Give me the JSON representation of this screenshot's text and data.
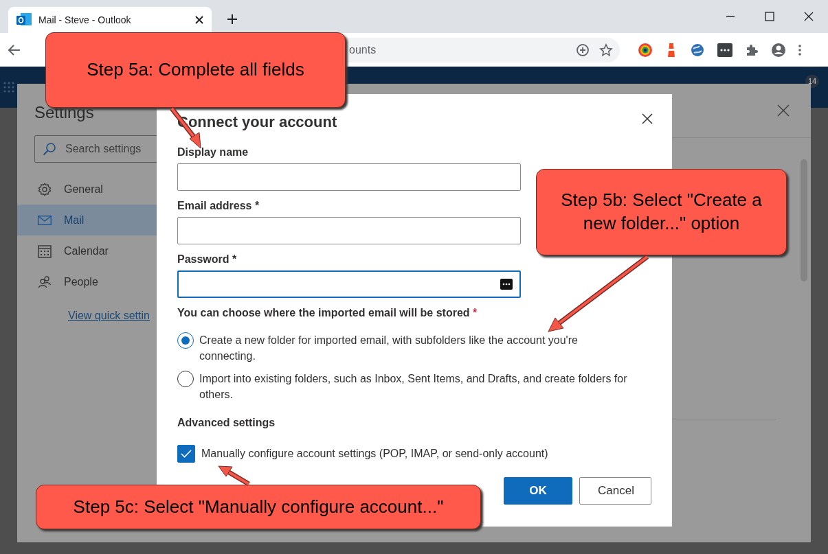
{
  "browser": {
    "tab_title": "Mail - Steve - Outlook",
    "address_text": "ounts",
    "header_badge": "14"
  },
  "settings": {
    "title": "Settings",
    "search": {
      "placeholder": "Search settings"
    },
    "nav_items": [
      {
        "label": "General",
        "selected": false
      },
      {
        "label": "Mail",
        "selected": true
      },
      {
        "label": "Calendar",
        "selected": false
      },
      {
        "label": "People",
        "selected": false
      }
    ],
    "link": "View quick settin"
  },
  "dialog": {
    "title": "Connect your account",
    "fields": [
      {
        "label": "Display name",
        "kind": "text",
        "focused": false
      },
      {
        "label": "Email address *",
        "kind": "text",
        "focused": false
      },
      {
        "label": "Password *",
        "kind": "password",
        "focused": true
      }
    ],
    "storage_question": "You can choose where the imported email will be stored",
    "required_mark": "*",
    "options": [
      {
        "label": "Create a new folder for imported email, with subfolders like the account you're connecting.",
        "selected": true
      },
      {
        "label": "Import into existing folders, such as Inbox, Sent Items, and Drafts, and create folders for others.",
        "selected": false
      }
    ],
    "advanced_heading": "Advanced settings",
    "checkbox": {
      "label": "Manually configure account settings (POP, IMAP, or send-only account)",
      "checked": true
    },
    "buttons": [
      {
        "label": "OK",
        "kind": "primary"
      },
      {
        "label": "Cancel",
        "kind": "secondary"
      }
    ]
  },
  "callouts": [
    {
      "text": "Step 5a: Complete all fields"
    },
    {
      "text": "Step 5b: Select \"Create a new folder...\" option"
    },
    {
      "text": "Step 5c: Select \"Manually configure account...\""
    }
  ]
}
